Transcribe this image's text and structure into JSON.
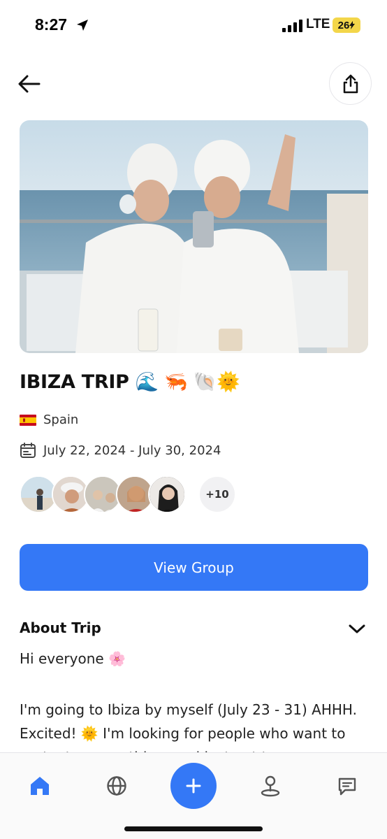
{
  "status_bar": {
    "time": "8:27",
    "network": "LTE",
    "battery": "26"
  },
  "trip": {
    "title": "IBIZA TRIP",
    "title_emojis": "🌊 🦐 🐚🌞",
    "location": "Spain",
    "dates": "July 22, 2024 - July 30, 2024",
    "extra_members": "+10"
  },
  "actions": {
    "view_group_label": "View Group"
  },
  "about": {
    "heading": "About Trip",
    "greeting": "Hi everyone 🌸",
    "body": "I'm going to Ibiza by myself (July 23 - 31) AHHH. Excited! 🌞 I'm looking for people who want to party, try everything, and just get to"
  },
  "icons": {
    "back": "arrow-left-icon",
    "share": "share-icon",
    "calendar": "calendar-icon",
    "chevron": "chevron-down-icon",
    "nav": [
      "home-icon",
      "globe-icon",
      "plus-icon",
      "map-pin-icon",
      "chat-icon"
    ]
  },
  "colors": {
    "accent": "#3478f6",
    "battery": "#f3d64a"
  }
}
